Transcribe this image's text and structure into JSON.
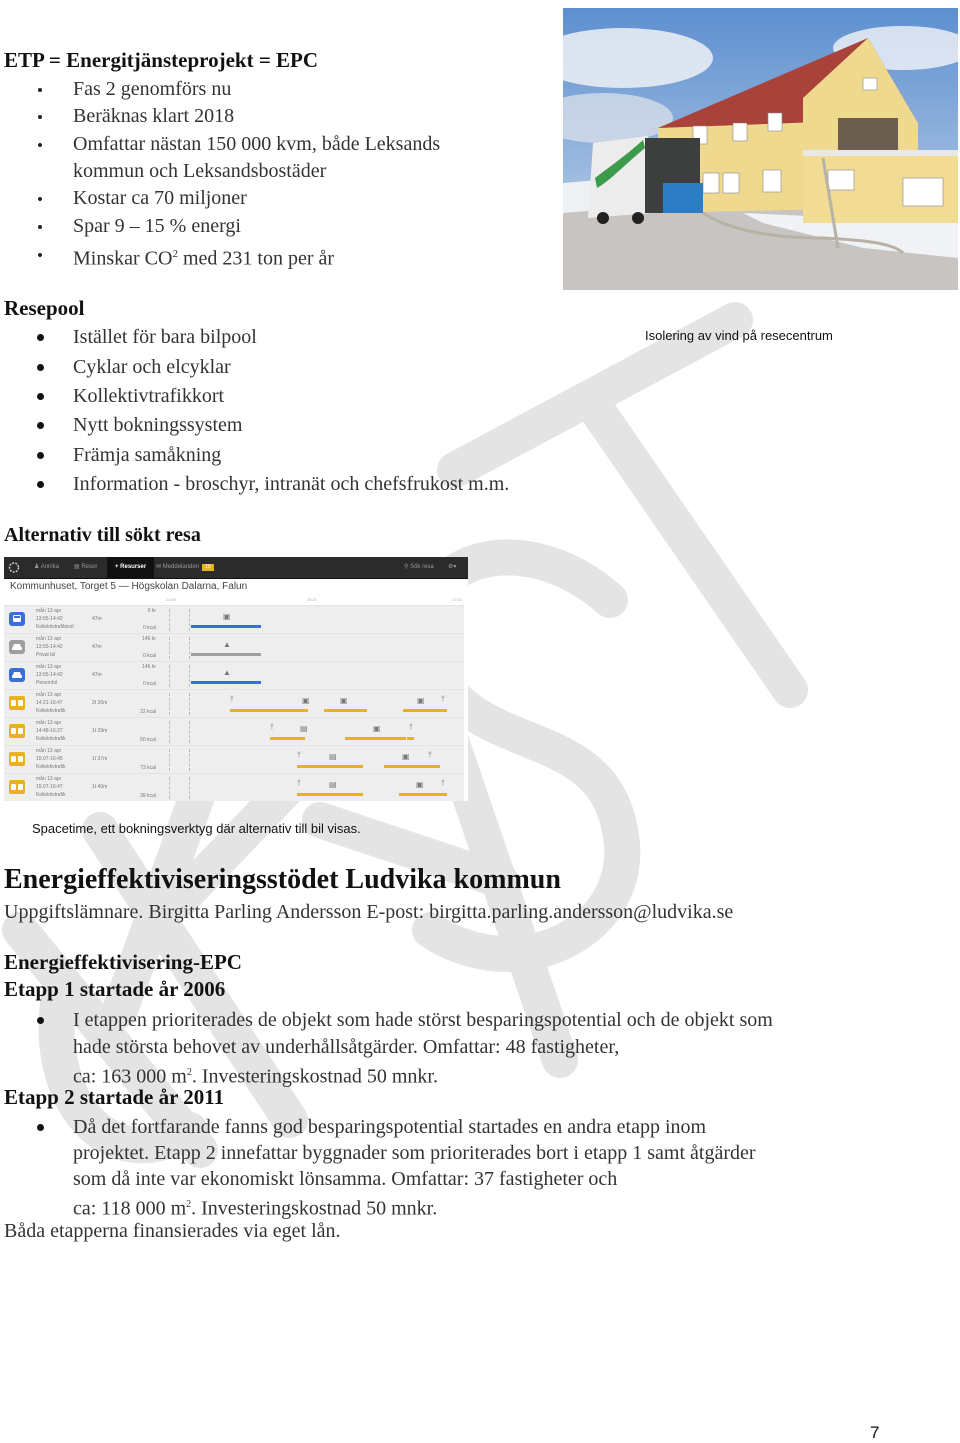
{
  "etp": {
    "heading": "ETP = Energitjänsteprojekt = EPC",
    "bullets": [
      "Fas 2 genomförs nu",
      "Beräknas klart 2018",
      "Omfattar nästan 150 000 kvm, både Leksands",
      "kommun och Leksandsbostäder",
      "Kostar ca 70 miljoner",
      "Spar 9 – 15 % energi"
    ],
    "co2_prefix": "Minskar CO",
    "co2_sup": "2",
    "co2_suffix": " med 231 ton per år"
  },
  "photo": {
    "caption": "Isolering av vind på resecentrum"
  },
  "resepool": {
    "heading": "Resepool",
    "bullets": [
      "Istället för bara bilpool",
      "Cyklar och elcyklar",
      "Kollektivtrafikkort",
      "Nytt bokningssystem",
      "Främja samåkning",
      "Information - broschyr, intranät och chefsfrukost m.m."
    ]
  },
  "alternativ": {
    "heading": "Alternativ till sökt resa"
  },
  "spacetime": {
    "nav": {
      "user": "Annika",
      "trips": "Resor",
      "resources": "Resurser",
      "messages": "Meddelanden",
      "messages_badge": "10",
      "search": "Sök resa"
    },
    "route": "Kommunhuset, Torget 5 — Högskolan Dalarna, Falun",
    "ticks": [
      "13:40",
      "15:21",
      "17:02"
    ],
    "colors": {
      "blue": "#3a6fd8",
      "grey": "#9e9e9e",
      "yellow": "#e8b21f",
      "nav": "#2b2b2b"
    },
    "rows": [
      {
        "date": "mån 13 apr",
        "time": "13:55-14:42",
        "type": "Kollektivtrafikkort",
        "duration": "47m",
        "cost": "0 kr",
        "kcal": "0 kcal",
        "icon": "bus-icon",
        "color": "blue"
      },
      {
        "date": "mån 13 apr",
        "time": "13:55-14:42",
        "type": "Privat bil",
        "duration": "47m",
        "cost": "146 kr",
        "kcal": "0 kcal",
        "icon": "car-icon",
        "color": "grey"
      },
      {
        "date": "mån 13 apr",
        "time": "13:55-14:42",
        "type": "Personbil",
        "duration": "47m",
        "cost": "146 kr",
        "kcal": "0 kcal",
        "icon": "car-icon",
        "color": "blue"
      },
      {
        "date": "mån 13 apr",
        "time": "14:21-16:47",
        "type": "Kollektivtrafik",
        "duration": "2t 26m",
        "cost": "",
        "kcal": "22 kcal",
        "icon": "transit-icon",
        "color": "yellow"
      },
      {
        "date": "mån 13 apr",
        "time": "14:48-16:27",
        "type": "Kollektivtrafik",
        "duration": "1t 39m",
        "cost": "",
        "kcal": "50 kcal",
        "icon": "transit-icon",
        "color": "yellow"
      },
      {
        "date": "mån 13 apr",
        "time": "15:07-16:45",
        "type": "Kollektivtrafik",
        "duration": "1t 37m",
        "cost": "",
        "kcal": "73 kcal",
        "icon": "transit-icon",
        "color": "yellow"
      },
      {
        "date": "mån 13 apr",
        "time": "15:07-16:47",
        "type": "Kollektivtrafik",
        "duration": "1t 40m",
        "cost": "",
        "kcal": "39 kcal",
        "icon": "transit-icon",
        "color": "yellow"
      }
    ],
    "caption": "Spacetime, ett bokningsverktyg där alternativ till bil visas."
  },
  "ludvika": {
    "heading": "Energieffektiviseringsstödet Ludvika kommun",
    "contact": "Uppgiftslämnare. Birgitta Parling Andersson E-post: birgitta.parling.andersson@ludvika.se",
    "epc_heading": "Energieffektivisering-EPC",
    "etapp1_heading": "Etapp 1 startade år 2006",
    "etapp1_lines": [
      "I etappen prioriterades de objekt som hade störst besparingspotential och de objekt som",
      "hade största behovet av underhållsåtgärder. Omfattar: 48 fastigheter,"
    ],
    "etapp1_last_prefix": "ca: 163 000 m",
    "etapp1_last_sup": "2",
    "etapp1_last_suffix": ". Investeringskostnad 50 mnkr.",
    "etapp2_heading": "Etapp 2 startade år 2011",
    "etapp2_lines": [
      "Då det fortfarande fanns god besparingspotential startades en andra etapp inom",
      "projektet. Etapp 2 innefattar byggnader som prioriterades bort i etapp 1 samt åtgärder",
      "som då inte var ekonomiskt lönsamma. Omfattar: 37 fastigheter och"
    ],
    "etapp2_last_prefix": "ca: 118 000 m",
    "etapp2_last_sup": "2",
    "etapp2_last_suffix": ".  Investeringskostnad 50 mnkr.",
    "footer": "Båda etapperna finansierades via eget lån."
  },
  "page_number": "7"
}
